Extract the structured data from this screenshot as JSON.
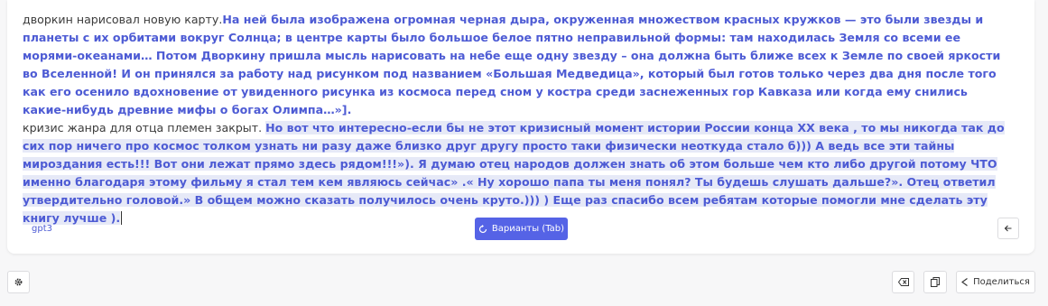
{
  "editor": {
    "paragraph1_plain": "дворкин нарисовал новую карту.",
    "paragraph1_generated": "На ней была изображена огромная черная дыра, окруженная множеством красных кружков — это были звезды и планеты с их орбитами вокруг Солнца; в центре карты было большое белое пятно неправильной формы: там находилась Земля со всеми ее морями-океанами… Потом Дворкину пришла мысль нарисовать на небе еще одну звезду – она должна быть ближе всех к Земле по своей яркости во Вселенной! И он принялся за работу над рисунком под названием «Большая Медведица», который был готов только через два дня после того как его осенило вдохновение от увиденного рисунка из космоса перед сном у костра среди заснеженных гор Кавказа или когда ему снились какие-нибудь древние мифы о богах Олимпа…»].",
    "paragraph2_plain": "кризис жанра для отца племен закрыт. ",
    "paragraph2_generated": " Но вот что интересно-если бы не этот кризисный момент истории России конца XX века , то мы никогда так до сих пор ничего про космос толком узнать ни разу даже близко друг другу просто таки физически неоткуда стало б))) А ведь все эти тайны мироздания есть!!! Вот они лежат прямо здесь рядом!!!»). Я думаю отец народов должен знать об этом больше чем кто либо другой потому ЧТО именно благодаря этому фильму я стал тем кем являюсь сейчас» .« Ну хорошо папа ты меня понял? Ты будешь слушать дальше?». Отец ответил утвердительно головой.» В общем можно сказать получилось очень круто.))) ) Еще раз спасибо всем ребятам которые помогли мне сделать эту книгу лучше )."
  },
  "toolbar": {
    "model_label": "gpt3",
    "variants_label": "Варианты (Tab)",
    "variants_icon": "refresh-icon",
    "back_icon": "arrow-left-icon"
  },
  "footer": {
    "settings_icon": "gear-icon",
    "clear_icon": "backspace-icon",
    "copy_icon": "copy-icon",
    "share_icon": "share-icon",
    "share_label": "Поделиться"
  },
  "colors": {
    "accent": "#5563e6",
    "generated_text": "#4d5bd4",
    "highlight": "#e6e9f7"
  }
}
